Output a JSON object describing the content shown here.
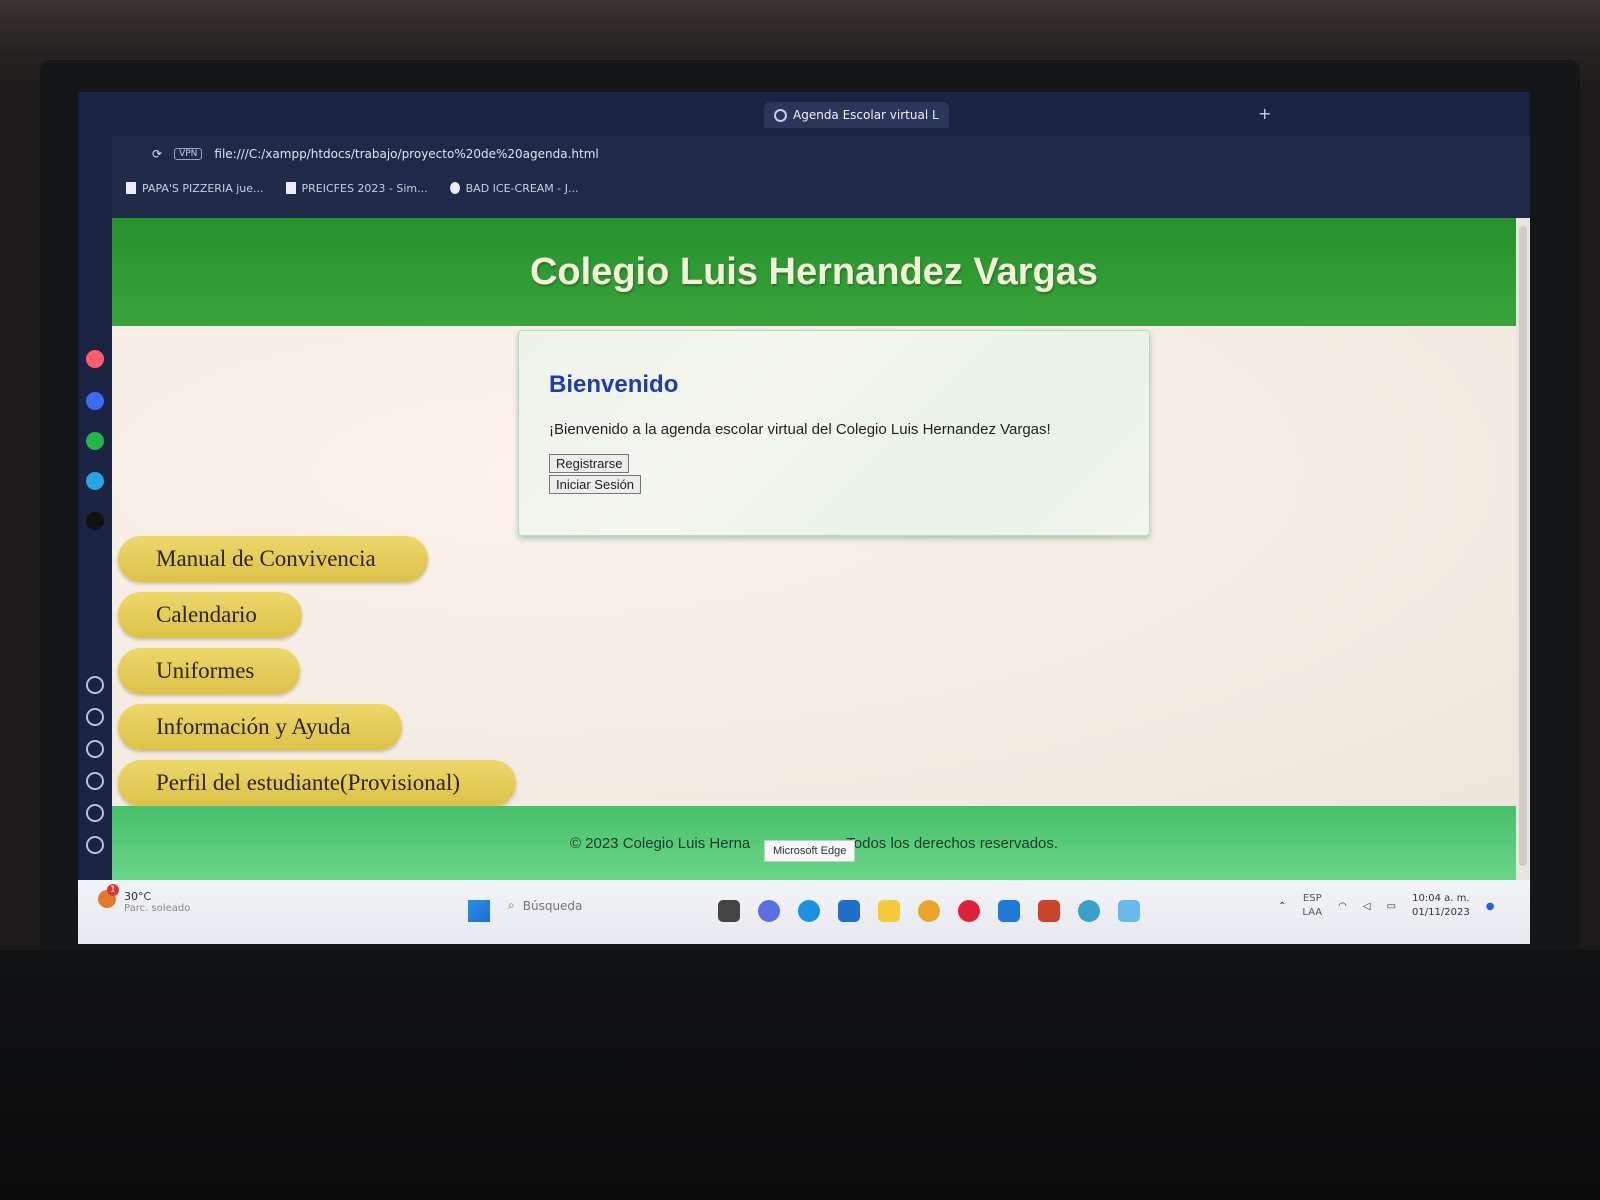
{
  "browser": {
    "tabs": [
      {
        "label": "Agenda Escolar virtual L",
        "active": true
      }
    ],
    "address_badge": "VPN",
    "url": "file:///C:/xampp/htdocs/trabajo/proyecto%20de%20agenda.html",
    "bookmarks": [
      {
        "label": "PAPA'S PIZZERIA jue..."
      },
      {
        "label": "PREICFES 2023 - Sim..."
      },
      {
        "label": "BAD ICE-CREAM - J..."
      }
    ]
  },
  "site": {
    "title": "Colegio Luis Hernandez Vargas",
    "welcome": {
      "heading": "Bienvenido",
      "text": "¡Bienvenido a la agenda escolar virtual del Colegio Luis Hernandez Vargas!",
      "register_label": "Registrarse",
      "login_label": "Iniciar Sesión"
    },
    "menu": [
      {
        "label": "Manual de Convivencia"
      },
      {
        "label": "Calendario"
      },
      {
        "label": "Uniformes"
      },
      {
        "label": "Información y Ayuda"
      },
      {
        "label": "Perfil del estudiante(Provisional)"
      }
    ],
    "footer_left": "© 2023 Colegio Luis Herna",
    "footer_right": "Todos los derechos reservados.",
    "tooltip": "Microsoft Edge"
  },
  "taskbar": {
    "weather_badge": "1",
    "weather_temp": "30°C",
    "weather_desc": "Parc. soleado",
    "search_placeholder": "Búsqueda",
    "lang_top": "ESP",
    "lang_bottom": "LAA",
    "time": "10:04 a. m.",
    "date": "01/11/2023"
  },
  "colors": {
    "header_green": "#2f9a33",
    "title_text": "#f4f0d8",
    "welcome_heading": "#1f3ab5",
    "menu_yellow": "#e3cc58",
    "footer_green": "#5ccb7c"
  }
}
